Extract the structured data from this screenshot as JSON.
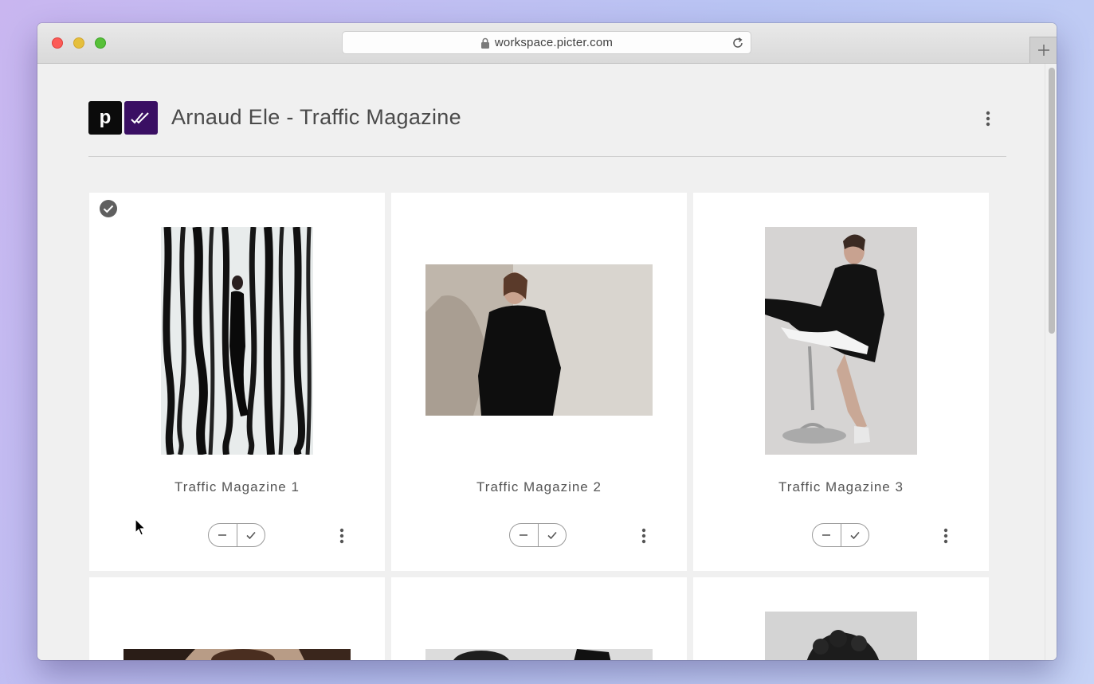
{
  "browser": {
    "url": "workspace.picter.com",
    "new_tab_label": "+"
  },
  "header": {
    "logo_letter": "p",
    "title": "Arnaud Ele - Traffic Magazine"
  },
  "cards": [
    {
      "title": "Traffic Magazine 1",
      "selected": true
    },
    {
      "title": "Traffic Magazine 2",
      "selected": false
    },
    {
      "title": "Traffic Magazine 3",
      "selected": false
    },
    {
      "title": "",
      "selected": false
    },
    {
      "title": "",
      "selected": false
    },
    {
      "title": "",
      "selected": false
    }
  ],
  "colors": {
    "logo_dark": "#0b0b0b",
    "logo_purple": "#3a0f63",
    "card_bg": "#ffffff",
    "page_bg": "#f0f0f0"
  },
  "icons": [
    "lock-icon",
    "reload-icon",
    "plus-icon",
    "kebab-icon",
    "minus-icon",
    "check-icon",
    "selected-check-icon",
    "cursor-icon"
  ]
}
